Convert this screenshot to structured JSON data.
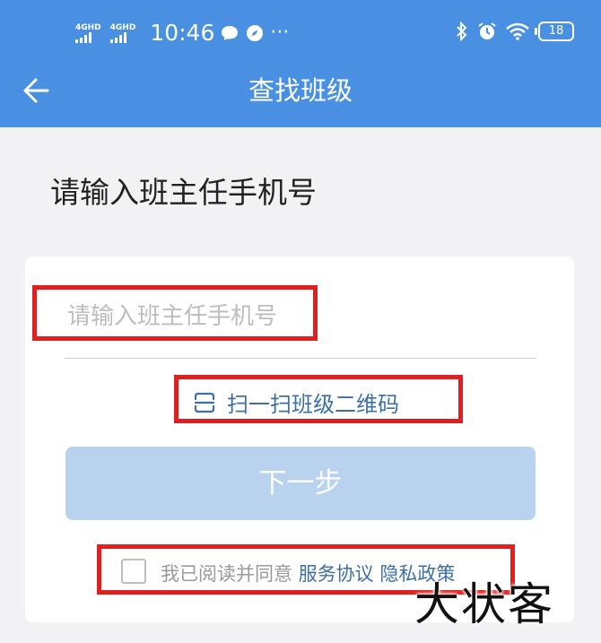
{
  "status_bar": {
    "network1": "4GHD",
    "network2": "4GHD",
    "time": "10:46",
    "more": "···",
    "battery": "18"
  },
  "header": {
    "title": "查找班级"
  },
  "main": {
    "prompt": "请输入班主任手机号",
    "phone_placeholder": "请输入班主任手机号",
    "scan_label": "扫一扫班级二维码",
    "next_label": "下一步",
    "agree_prefix": "我已阅读并同意",
    "service_link": "服务协议",
    "privacy_link": "隐私政策"
  },
  "watermark": "大状客",
  "colors": {
    "header_bg": "#4a90e2",
    "link": "#3c6fa8",
    "button_disabled": "#b9d3ee",
    "highlight": "#e0201f"
  }
}
